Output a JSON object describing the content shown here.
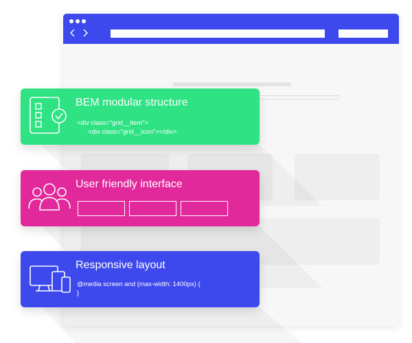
{
  "features": [
    {
      "title": "BEM modular structure",
      "code_lines": [
        "<div class=\"grid__item\">",
        "<div class=\"grid__icon\"></div>"
      ],
      "color": "#2fe283",
      "icon": "checklist-icon"
    },
    {
      "title": "User friendly interface",
      "color": "#e1299b",
      "icon": "users-icon"
    },
    {
      "title": "Responsive layout",
      "code_lines": [
        "@media screen and (max-width: 1400px) {",
        "}"
      ],
      "color": "#3d49ec",
      "icon": "devices-icon"
    }
  ],
  "colors": {
    "browser_bar": "#3d49ec",
    "placeholder": "#eeeeee"
  }
}
